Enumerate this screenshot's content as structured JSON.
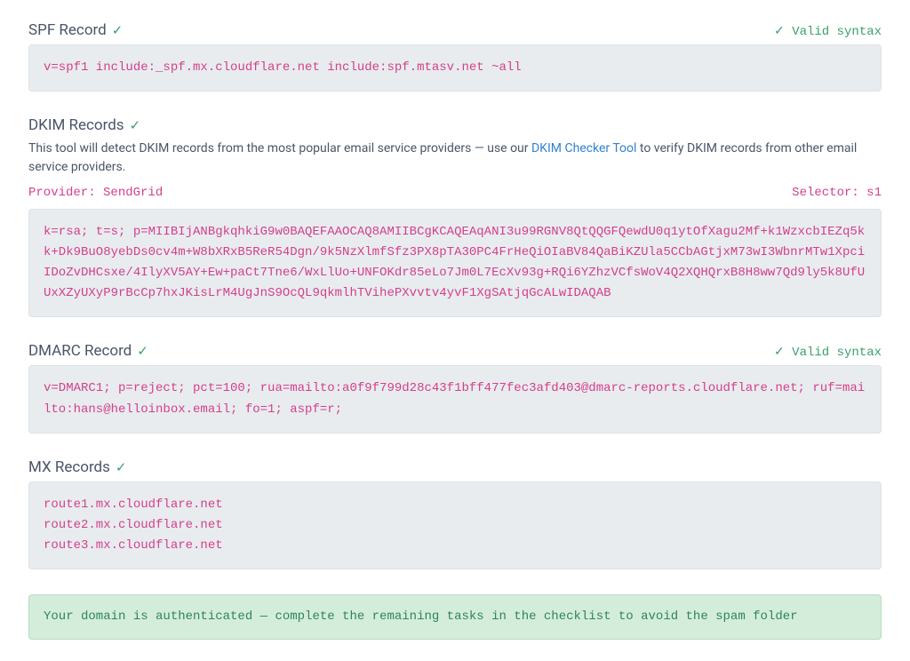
{
  "spf": {
    "title": "SPF Record",
    "validLabel": "✓ Valid syntax",
    "code": "v=spf1 include:_spf.mx.cloudflare.net include:spf.mtasv.net ~all"
  },
  "dkim": {
    "title": "DKIM Records",
    "subtextPre": "This tool will detect DKIM records from the most popular email service providers — use our ",
    "linkText": "DKIM Checker Tool",
    "subtextPost": " to verify DKIM records from other email service providers.",
    "provider": "Provider: SendGrid",
    "selector": "Selector: s1",
    "code": "k=rsa; t=s; p=MIIBIjANBgkqhkiG9w0BAQEFAAOCAQ8AMIIBCgKCAQEAqANI3u99RGNV8QtQQGFQewdU0q1ytOfXagu2Mf+k1WzxcbIEZq5kk+Dk9BuO8yebDs0cv4m+W8bXRxB5ReR54Dgn/9k5NzXlmfSfz3PX8pTA30PC4FrHeQiOIaBV84QaBiKZUla5CCbAGtjxM73wI3WbnrMTw1XpciIDoZvDHCsxe/4IlyXV5AY+Ew+paCt7Tne6/WxLlUo+UNFOKdr85eLo7Jm0L7EcXv93g+RQi6YZhzVCfsWoV4Q2XQHQrxB8H8ww7Qd9ly5k8UfUUxXZyUXyP9rBcCp7hxJKisLrM4UgJnS9OcQL9qkmlhTVihePXvvtv4yvF1XgSAtjqGcALwIDAQAB"
  },
  "dmarc": {
    "title": "DMARC Record",
    "validLabel": "✓ Valid syntax",
    "code": "v=DMARC1; p=reject; pct=100; rua=mailto:a0f9f799d28c43f1bff477fec3afd403@dmarc-reports.cloudflare.net; ruf=mailto:hans@helloinbox.email; fo=1; aspf=r;"
  },
  "mx": {
    "title": "MX Records",
    "records": "route1.mx.cloudflare.net\nroute2.mx.cloudflare.net\nroute3.mx.cloudflare.net"
  },
  "success": {
    "message": "Your domain is authenticated — complete the remaining tasks in the checklist to avoid the spam folder"
  },
  "glyphs": {
    "check": "✓"
  }
}
